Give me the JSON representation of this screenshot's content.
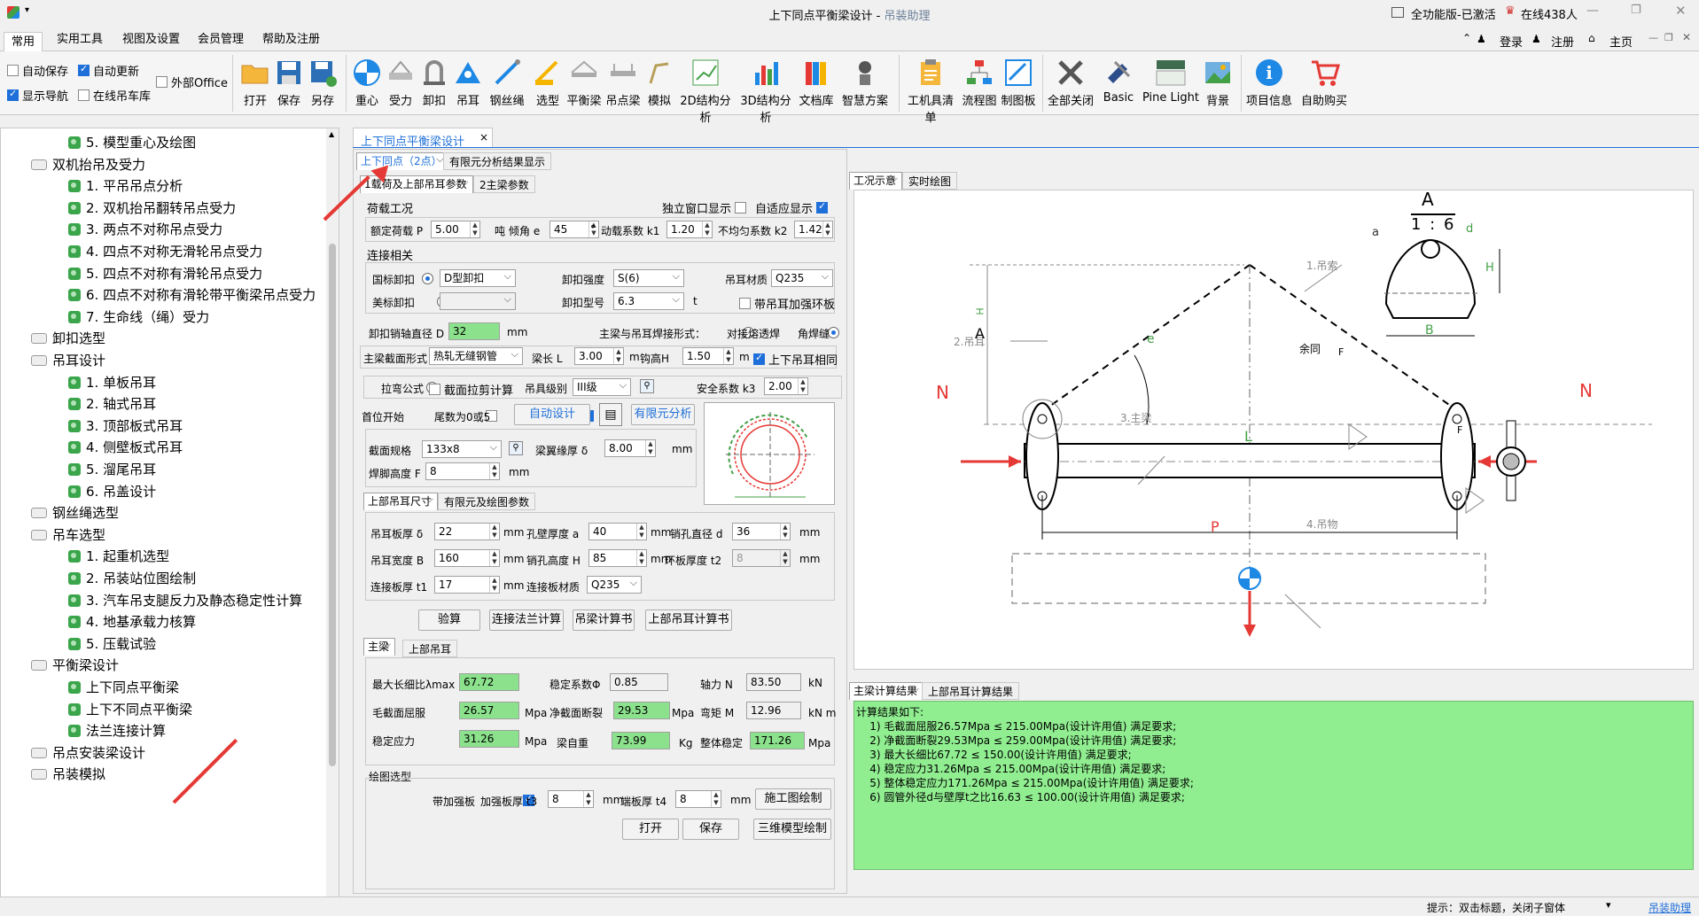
{
  "window": {
    "title": "上下同点平衡梁设计",
    "app": "吊装助理",
    "license": "全功能版-已激活",
    "online": "在线438人"
  },
  "menu": [
    "常用",
    "实用工具",
    "视图及设置",
    "会员管理",
    "帮助及注册"
  ],
  "topright": {
    "login": "登录",
    "register": "注册",
    "home": "主页"
  },
  "options": {
    "auto_save": "自动保存",
    "auto_update": "自动更新",
    "external_office": "外部Office",
    "show_nav": "显示导航",
    "online_crane_db": "在线吊车库"
  },
  "ribbon": [
    "打开",
    "保存",
    "另存",
    "重心",
    "受力",
    "卸扣",
    "吊耳",
    "钢丝绳",
    "选型",
    "平衡梁",
    "吊点梁",
    "模拟",
    "2D结构分析",
    "3D结构分析",
    "文档库",
    "智慧方案",
    "工机具清单",
    "流程图",
    "制图板",
    "全部关闭",
    "Basic",
    "Pine Light",
    "背景",
    "项目信息",
    "自助购买"
  ],
  "tree": [
    {
      "label": "5. 模型重心及绘图",
      "level": 2,
      "icon": "leaf"
    },
    {
      "label": "双机抬吊及受力",
      "level": 1,
      "icon": "group"
    },
    {
      "label": "1. 平吊吊点分析",
      "level": 2,
      "icon": "leaf"
    },
    {
      "label": "2. 双机抬吊翻转吊点受力",
      "level": 2,
      "icon": "leaf"
    },
    {
      "label": "3. 两点不对称吊点受力",
      "level": 2,
      "icon": "leaf"
    },
    {
      "label": "4. 四点不对称无滑轮吊点受力",
      "level": 2,
      "icon": "leaf"
    },
    {
      "label": "5. 四点不对称有滑轮吊点受力",
      "level": 2,
      "icon": "leaf"
    },
    {
      "label": "6. 四点不对称有滑轮带平衡梁吊点受力",
      "level": 2,
      "icon": "leaf"
    },
    {
      "label": "7. 生命线（绳）受力",
      "level": 2,
      "icon": "leaf"
    },
    {
      "label": "卸扣选型",
      "level": 1,
      "icon": "group"
    },
    {
      "label": "吊耳设计",
      "level": 1,
      "icon": "group"
    },
    {
      "label": "1. 单板吊耳",
      "level": 2,
      "icon": "leaf"
    },
    {
      "label": "2. 轴式吊耳",
      "level": 2,
      "icon": "leaf"
    },
    {
      "label": "3. 顶部板式吊耳",
      "level": 2,
      "icon": "leaf"
    },
    {
      "label": "4. 侧壁板式吊耳",
      "level": 2,
      "icon": "leaf"
    },
    {
      "label": "5. 溜尾吊耳",
      "level": 2,
      "icon": "leaf"
    },
    {
      "label": "6. 吊盖设计",
      "level": 2,
      "icon": "leaf"
    },
    {
      "label": "钢丝绳选型",
      "level": 1,
      "icon": "rope"
    },
    {
      "label": "吊车选型",
      "level": 1,
      "icon": "group"
    },
    {
      "label": "1. 起重机选型",
      "level": 2,
      "icon": "leaf"
    },
    {
      "label": "2. 吊装站位图绘制",
      "level": 2,
      "icon": "leaf"
    },
    {
      "label": "3. 汽车吊支腿反力及静态稳定性计算",
      "level": 2,
      "icon": "leaf"
    },
    {
      "label": "4. 地基承载力核算",
      "level": 2,
      "icon": "leaf"
    },
    {
      "label": "5. 压载试验",
      "level": 2,
      "icon": "leaf"
    },
    {
      "label": "平衡梁设计",
      "level": 1,
      "icon": "group"
    },
    {
      "label": "上下同点平衡梁",
      "level": 2,
      "icon": "leaf"
    },
    {
      "label": "上下不同点平衡梁",
      "level": 2,
      "icon": "leaf"
    },
    {
      "label": "法兰连接计算",
      "level": 2,
      "icon": "leaf"
    },
    {
      "label": "吊点安装梁设计",
      "level": 1,
      "icon": "group"
    },
    {
      "label": "吊装模拟",
      "level": 1,
      "icon": "group"
    }
  ],
  "doc_tab": "上下同点平衡梁设计",
  "main_tabs": [
    "上下同点（2点）",
    "有限元分析结果显示"
  ],
  "sub_tabs": [
    "1载荷及上部吊耳参数",
    "2主梁参数"
  ],
  "load": {
    "group": "荷载工况",
    "independent": "独立窗口显示",
    "adaptive": "自适应显示",
    "rated_label": "额定荷载 P",
    "rated": "5.00",
    "rated_unit": "吨",
    "tilt_label": "倾角 e",
    "tilt": "45",
    "tilt_unit": "°",
    "dyn_label": "动载系数 k1",
    "dyn": "1.20",
    "uneven_label": "不均匀系数 k2",
    "uneven": "1.42"
  },
  "conn": {
    "group": "连接相关",
    "national": "国标卸扣",
    "shackle_type": "D型卸扣",
    "strength_label": "卸扣强度",
    "strength": "S(6)",
    "material_label": "吊耳材质",
    "material": "Q235",
    "american": "美标卸扣",
    "model_label": "卸扣型号",
    "model": "6.3",
    "model_unit": "t",
    "ring": "带吊耳加强环板",
    "pin_label": "卸扣销轴直径 D",
    "pin": "32",
    "pin_unit": "mm",
    "weld_label": "主梁与吊耳焊接形式：",
    "butt": "对接熔透焊",
    "fillet": "角焊缝"
  },
  "beam": {
    "section_label": "主梁截面形式",
    "section": "热轧无缝钢管",
    "len_label": "梁长 L",
    "len": "3.00",
    "len_unit": "m",
    "hook_label": "钩高H",
    "hook": "1.50",
    "hook_unit": "m",
    "same": "上下吊耳相同"
  },
  "calc": {
    "formula": "拉弯公式",
    "shear": "截面拉剪计算",
    "grade_label": "吊具级别",
    "grade": "III级",
    "safety_label": "安全系数 k3",
    "safety": "2.00",
    "first": "首位开始",
    "tail": "尾数为0或5",
    "auto": "自动设计",
    "fea": "有限元分析"
  },
  "section": {
    "spec_label": "截面规格",
    "spec": "133x8",
    "flange_label": "梁翼缘厚 δ",
    "flange": "8.00",
    "flange_unit": "mm",
    "weld_label": "焊脚高度 F",
    "weld": "8",
    "weld_unit": "mm"
  },
  "lug_tabs": [
    "上部吊耳尺寸",
    "有限元及绘图参数"
  ],
  "lug": {
    "thk_label": "吊耳板厚 δ",
    "thk": "22",
    "wall_label": "孔壁厚度 a",
    "wall": "40",
    "pinhole_label": "销孔直径 d",
    "pinhole": "36",
    "width_label": "吊耳宽度 B",
    "width": "160",
    "height_label": "销孔高度 H",
    "height": "85",
    "ring_label": "环板厚度 t2",
    "ring": "8",
    "plate_label": "连接板厚 t1",
    "plate": "17",
    "pmat_label": "连接板材质",
    "pmat": "Q235",
    "mm": "mm"
  },
  "actions": [
    "验算",
    "连接法兰计算",
    "吊梁计算书",
    "上部吊耳计算书"
  ],
  "res_tabs": [
    "主梁",
    "上部吊耳"
  ],
  "res": {
    "slender_label": "最大长细比λmax",
    "slender": "67.72",
    "stab_coef_label": "稳定系数Φ",
    "stab_coef": "0.85",
    "axial_label": "轴力 N",
    "axial": "83.50",
    "axial_unit": "kN",
    "gross_label": "毛截面屈服",
    "gross": "26.57",
    "gross_unit": "Mpa",
    "net_label": "净截面断裂",
    "net": "29.53",
    "net_unit": "Mpa",
    "moment_label": "弯矩 M",
    "moment": "12.96",
    "moment_unit": "kN m",
    "stab_label": "稳定应力",
    "stab": "31.26",
    "stab_unit": "Mpa",
    "weight_label": "梁自重",
    "weight": "73.99",
    "weight_unit": "Kg",
    "overall_label": "整体稳定",
    "overall": "171.26",
    "overall_unit": "Mpa"
  },
  "draw": {
    "group": "绘图选型",
    "stiff": "带加强板",
    "stiff_thk_label": "加强板厚 t3",
    "stiff_thk": "8",
    "end_thk_label": "端板厚 t4",
    "end_thk": "8",
    "mm": "mm",
    "site_btn": "施工图绘制",
    "open": "打开",
    "save": "保存",
    "model3d": "三维模型绘制"
  },
  "right_tabs": [
    "工况示意",
    "实时绘图"
  ],
  "diagram": {
    "scale_a": "A",
    "scale": "1 : 6",
    "sling": "1.吊索",
    "lug": "2.吊耳",
    "beam": "3.主梁",
    "cargo": "4.吊物",
    "same": "余同",
    "N": "N",
    "P": "P",
    "L": "L",
    "H": "H",
    "A": "A",
    "a": "a",
    "d": "d",
    "B": "B",
    "e": "e",
    "F": "F"
  },
  "result_tabs": [
    "主梁计算结果",
    "上部吊耳计算结果"
  ],
  "results_text": "计算结果如下:\n    1) 毛截面屈服26.57Mpa ≤ 215.00Mpa(设计许用值) 满足要求;\n    2) 净截面断裂29.53Mpa ≤ 259.00Mpa(设计许用值) 满足要求;\n    3) 最大长细比67.72 ≤ 150.00(设计许用值) 满足要求;\n    4) 稳定应力31.26Mpa ≤ 215.00Mpa(设计许用值) 满足要求;\n    5) 整体稳定应力171.26Mpa ≤ 215.00Mpa(设计许用值) 满足要求;\n    6) 圆管外径d与壁厚t之比16.63 ≤ 100.00(设计许用值) 满足要求;",
  "status": {
    "hint": "提示：双击标题，关闭子窗体",
    "link": "吊装助理"
  },
  "colors": {
    "green": "#8be18c",
    "result_bg": "#90ee90",
    "accent": "#1e6fd9",
    "arrow": "#e53935"
  }
}
